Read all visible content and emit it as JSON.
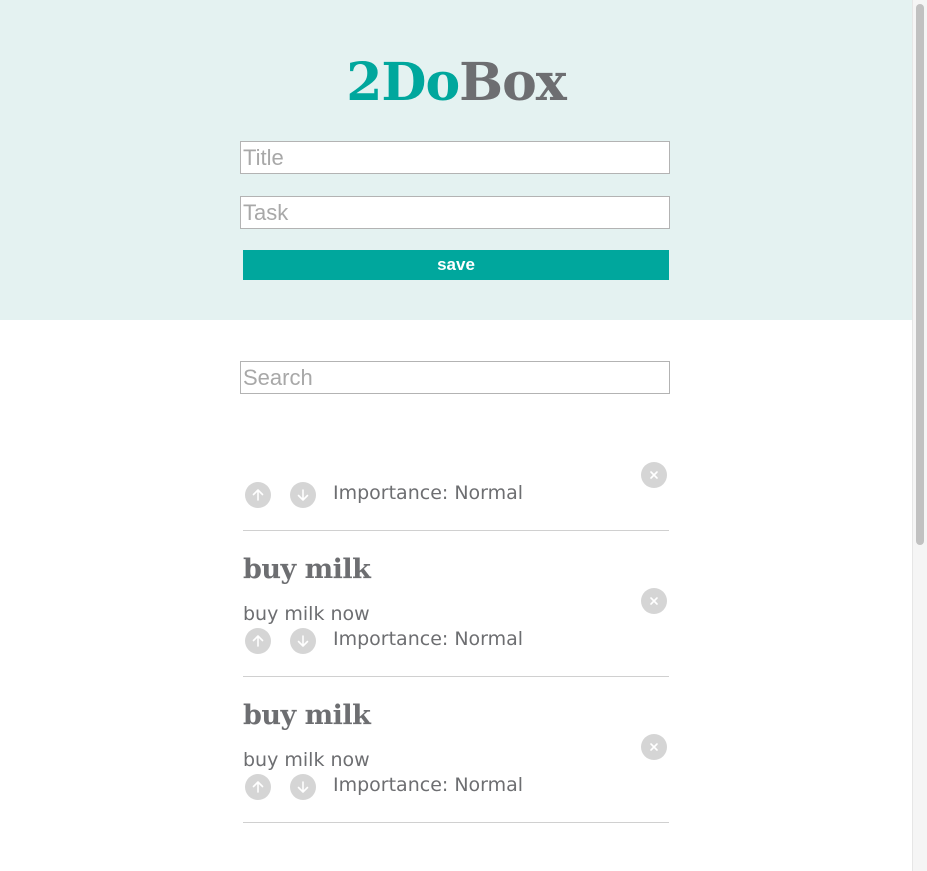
{
  "header": {
    "logo_part_a": "2Do",
    "logo_part_b": "Box",
    "title_placeholder": "Title",
    "task_placeholder": "Task",
    "save_label": "save"
  },
  "search": {
    "placeholder": "Search"
  },
  "importance_label": "Importance:",
  "cards": [
    {
      "title": "",
      "body": "",
      "importance": "Normal"
    },
    {
      "title": "buy milk",
      "body": "buy milk now",
      "importance": "Normal"
    },
    {
      "title": "buy milk",
      "body": "buy milk now",
      "importance": "Normal"
    }
  ],
  "icons": {
    "upvote": "arrow-up-icon",
    "downvote": "arrow-down-icon",
    "delete": "close-icon"
  },
  "colors": {
    "accent": "#00a79d",
    "text": "#6d6e71",
    "header_bg": "#e4f2f1",
    "icon_bg": "#d5d5d5"
  }
}
